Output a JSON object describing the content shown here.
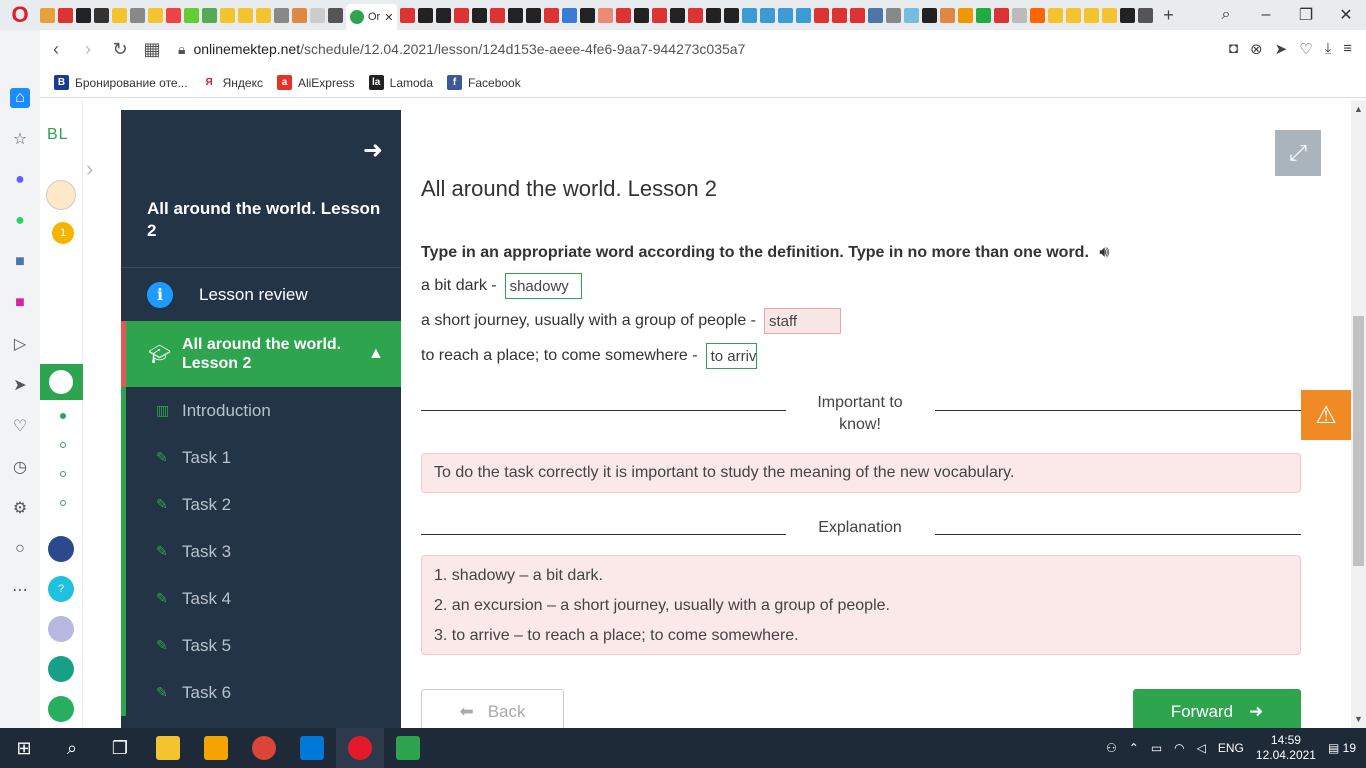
{
  "browser": {
    "active_tab_title": "Or",
    "url_domain": "onlinemektep.net",
    "url_path": "/schedule/12.04.2021/lesson/124d153e-aeee-4fe6-9aa7-944273c035a7",
    "bookmarks": [
      {
        "label": "Бронирование оте...",
        "icon": "booking-icon",
        "color": "#1a3d8f"
      },
      {
        "label": "Яндекс",
        "icon": "yandex-icon",
        "color": "#ffffff"
      },
      {
        "label": "AliExpress",
        "icon": "aliexpress-icon",
        "color": "#e43225"
      },
      {
        "label": "Lamoda",
        "icon": "lamoda-icon",
        "color": "#222222"
      },
      {
        "label": "Facebook",
        "icon": "facebook-icon",
        "color": "#3b5998"
      }
    ]
  },
  "site_rail": {
    "logo": "BL",
    "badge_count": "1"
  },
  "lesson_nav": {
    "title": "All around the world. Lesson 2",
    "review_label": "Lesson review",
    "active_label": "All around the world. Lesson 2",
    "items": [
      {
        "label": "Introduction",
        "icon": "book-icon"
      },
      {
        "label": "Task 1",
        "icon": "edit-icon"
      },
      {
        "label": "Task 2",
        "icon": "edit-icon"
      },
      {
        "label": "Task 3",
        "icon": "edit-icon"
      },
      {
        "label": "Task 4",
        "icon": "edit-icon"
      },
      {
        "label": "Task 5",
        "icon": "edit-icon"
      },
      {
        "label": "Task 6",
        "icon": "edit-icon"
      }
    ]
  },
  "content": {
    "lesson_title": "All around the world. Lesson 2",
    "instruction": "Type in an appropriate word according to the definition. Type in no more than one word.",
    "questions": [
      {
        "prompt": "a bit dark -",
        "answer": "shadowy",
        "correct": true
      },
      {
        "prompt": "a short journey, usually with a group of people -",
        "answer": "staff",
        "correct": false
      },
      {
        "prompt": "to reach a place; to come somewhere -",
        "answer": "to arriv",
        "correct": true
      }
    ],
    "important_heading": "Important to know!",
    "important_text": "To do the task correctly it is important to study the meaning of the new vocabulary.",
    "explanation_heading": "Explanation",
    "explanations": [
      "1. shadowy – a bit dark.",
      "2. an excursion – a short journey, usually with a group of people.",
      "3. to arrive – to reach a place; to come somewhere."
    ],
    "back_label": "Back",
    "forward_label": "Forward"
  },
  "taskbar": {
    "lang": "ENG",
    "time": "14:59",
    "date": "12.04.2021",
    "notifications": "19"
  },
  "colors": {
    "accent_green": "#2ea44f",
    "nav_bg": "#243447",
    "warning_orange": "#f08a24",
    "error_pink": "#fbe8e8"
  }
}
